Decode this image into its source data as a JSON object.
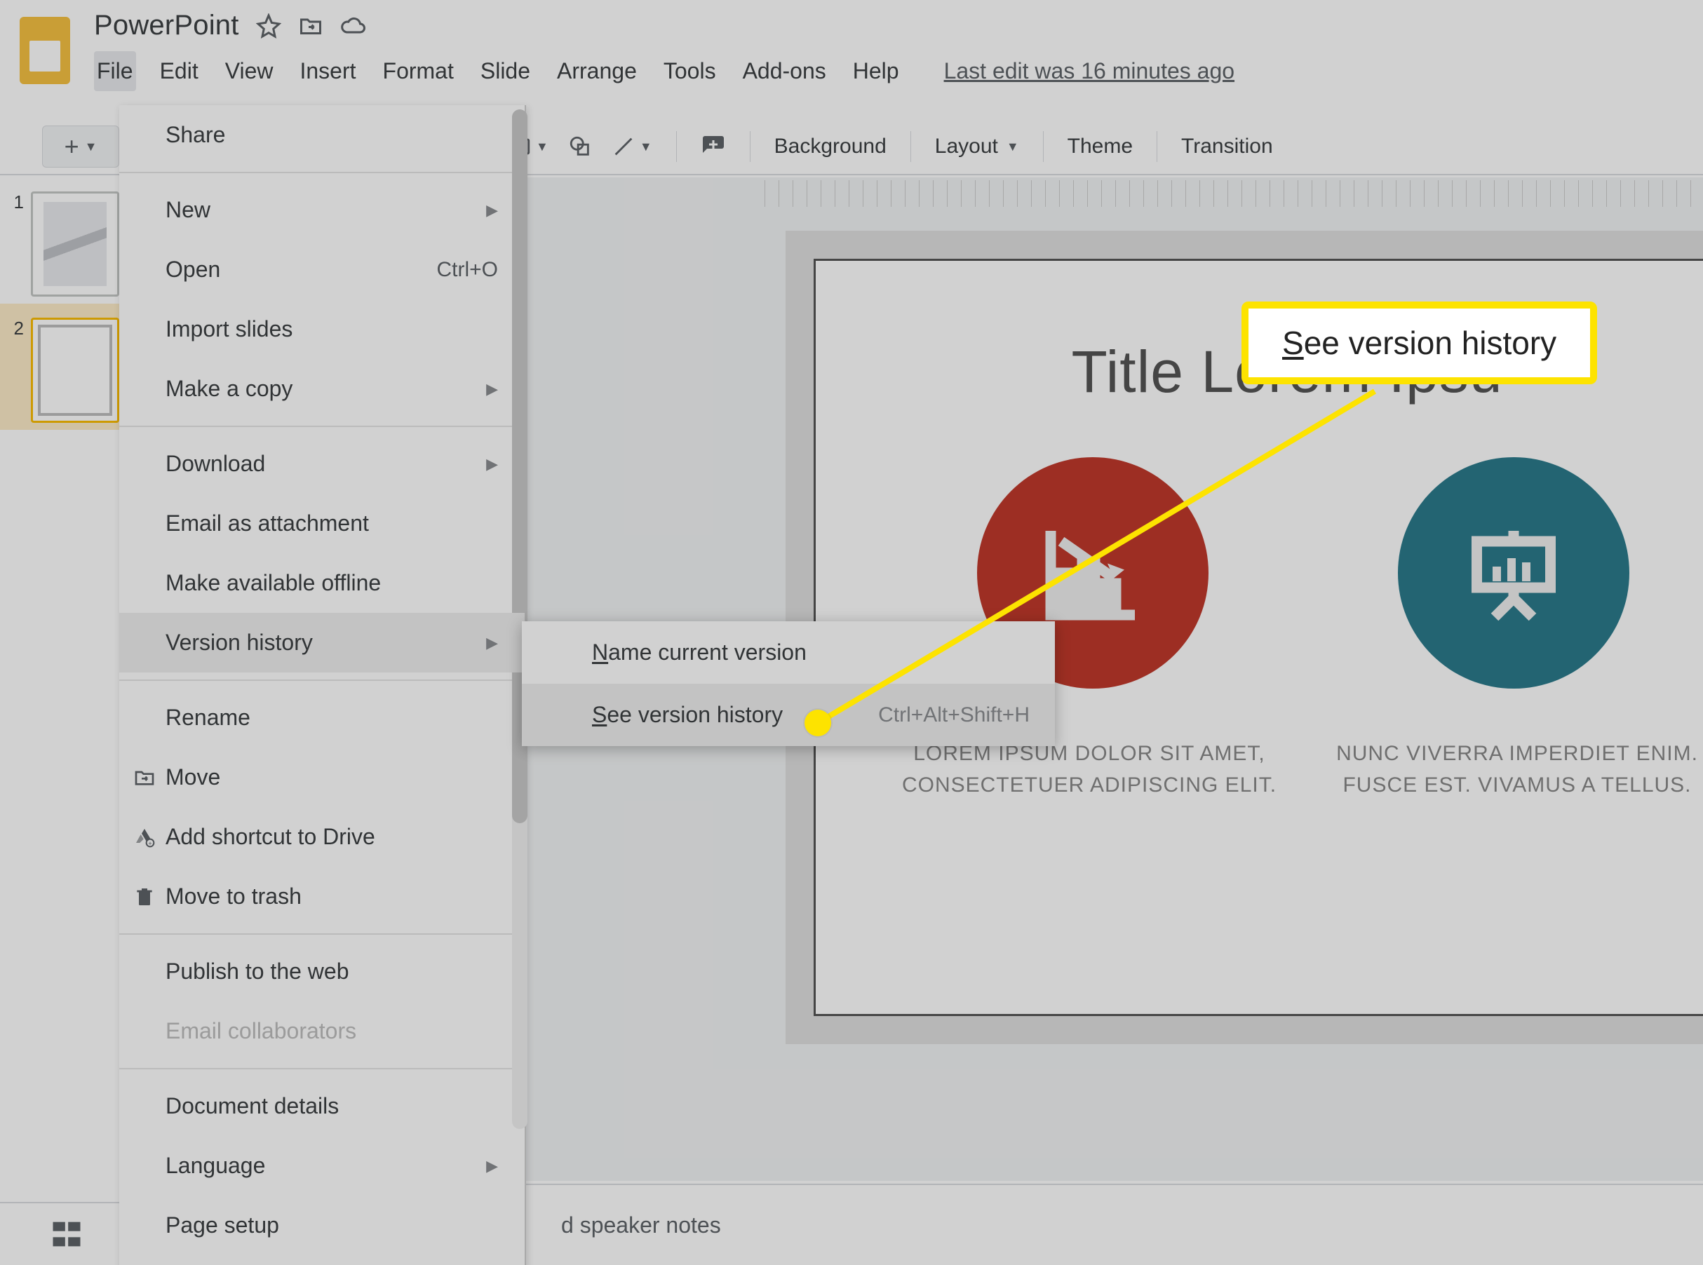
{
  "doc": {
    "title": "PowerPoint"
  },
  "menubar": {
    "file": "File",
    "edit": "Edit",
    "view": "View",
    "insert": "Insert",
    "format": "Format",
    "slide": "Slide",
    "arrange": "Arrange",
    "tools": "Tools",
    "addons": "Add-ons",
    "help": "Help",
    "last_edit": "Last edit was 16 minutes ago"
  },
  "toolbar": {
    "background": "Background",
    "layout": "Layout",
    "theme": "Theme",
    "transition": "Transition"
  },
  "filmstrip": {
    "n1": "1",
    "n2": "2"
  },
  "slide": {
    "title": "Title Lorem Ipsu",
    "cap1a": "LOREM IPSUM DOLOR SIT AMET,",
    "cap1b": "CONSECTETUER ADIPISCING ELIT.",
    "cap2a": "NUNC VIVERRA IMPERDIET ENIM.",
    "cap2b": "FUSCE EST. VIVAMUS A TELLUS."
  },
  "notes": {
    "placeholder": "d speaker notes"
  },
  "file_menu": {
    "share": "Share",
    "new": "New",
    "open": "Open",
    "open_kbd": "Ctrl+O",
    "import": "Import slides",
    "copy": "Make a copy",
    "download": "Download",
    "email_attach": "Email as attachment",
    "offline": "Make available offline",
    "version_history": "Version history",
    "rename": "Rename",
    "move": "Move",
    "add_shortcut": "Add shortcut to Drive",
    "trash": "Move to trash",
    "publish": "Publish to the web",
    "email_collab": "Email collaborators",
    "doc_details": "Document details",
    "language": "Language",
    "page_setup": "Page setup"
  },
  "submenu": {
    "name_current_pre": "N",
    "name_current_rest": "ame current version",
    "see_history_pre": "S",
    "see_history_rest": "ee version history",
    "see_history_kbd": "Ctrl+Alt+Shift+H"
  },
  "callout": {
    "pre": "S",
    "rest": "ee version history"
  }
}
